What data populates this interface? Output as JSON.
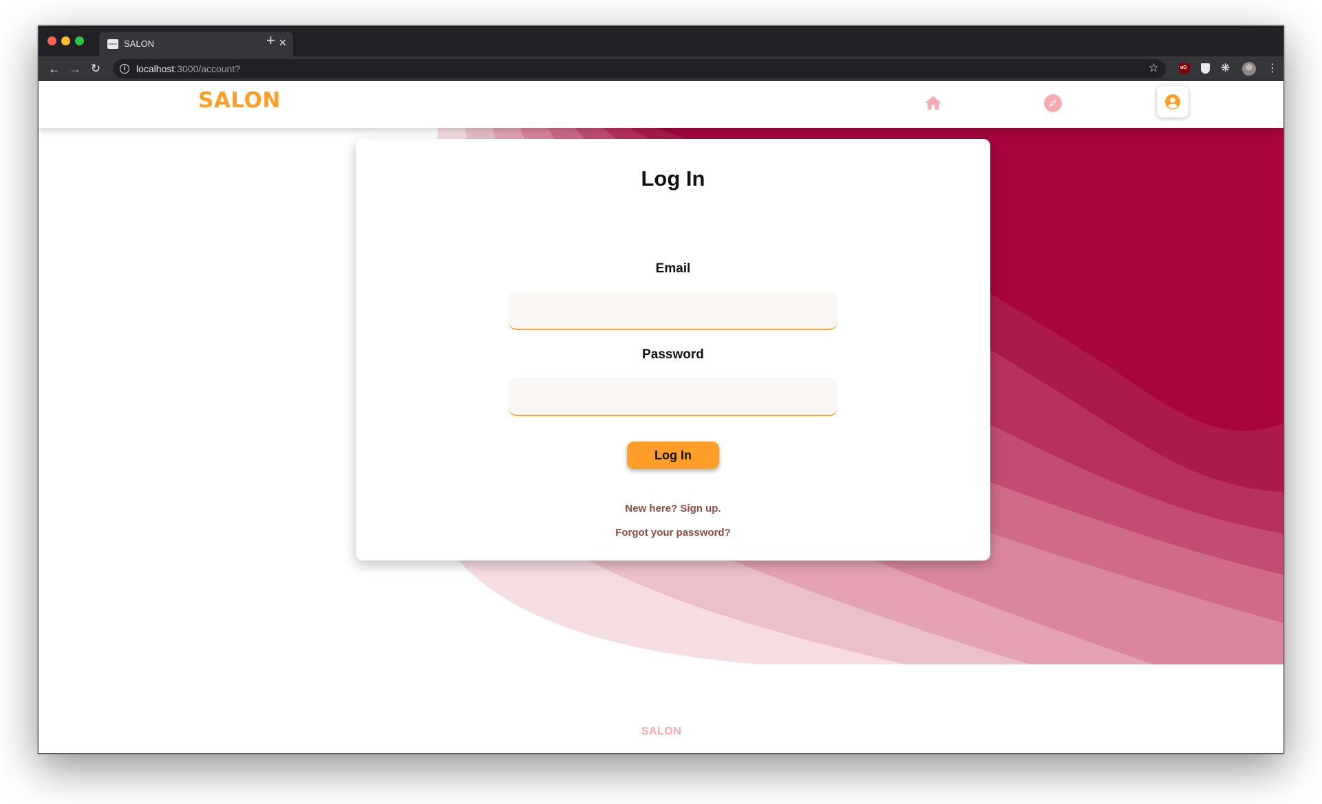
{
  "browser": {
    "tab_title": "SALON",
    "tab_close": "×",
    "new_tab": "+",
    "url_host": "localhost",
    "url_path": ":3000/account?"
  },
  "header": {
    "logo": "SALON",
    "nav": [
      {
        "name": "home",
        "icon": "home-icon"
      },
      {
        "name": "explore",
        "icon": "compass-icon"
      },
      {
        "name": "account",
        "icon": "account-circle-icon",
        "active": true
      }
    ]
  },
  "login": {
    "title": "Log In",
    "email_label": "Email",
    "email_value": "",
    "password_label": "Password",
    "password_value": "",
    "submit_label": "Log In",
    "signup_link": "New here? Sign up.",
    "forgot_link": "Forgot your password?"
  },
  "footer": {
    "logo": "SALON"
  },
  "colors": {
    "brand_orange": "#ff9f29",
    "wave_dark": "#a6053e",
    "link_brown": "#8b4a3f",
    "nav_icon_pink": "#f7a8b0"
  }
}
